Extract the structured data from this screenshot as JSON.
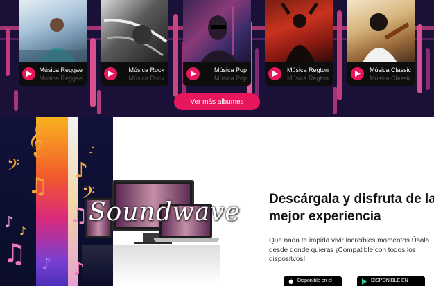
{
  "genres": [
    {
      "title": "Música Reggae",
      "subtitle": "Música Reggae"
    },
    {
      "title": "Música Rock",
      "subtitle": "Música Rock"
    },
    {
      "title": "Música Pop",
      "subtitle": "Música Pop"
    },
    {
      "title": "Música Regton",
      "subtitle": "Música Regton"
    },
    {
      "title": "Música Classic",
      "subtitle": "Música Classic"
    }
  ],
  "more_button": "Ver más albumes",
  "logo_text": "Soundwave",
  "promo": {
    "headline_line1": "Descárgala y disfruta de la",
    "headline_line2": "mejor experiencia",
    "description": "Que nada te impida vivir increíbles momentos Úsala desde donde quieras ¡Compatible con todos los dispositvos!"
  },
  "stores": {
    "apple_label": "Disponible en el",
    "google_label": "DISPONIBLE EN"
  },
  "colors": {
    "accent": "#e8175d",
    "band_background": "#1a1038",
    "text_dark": "#111111"
  }
}
